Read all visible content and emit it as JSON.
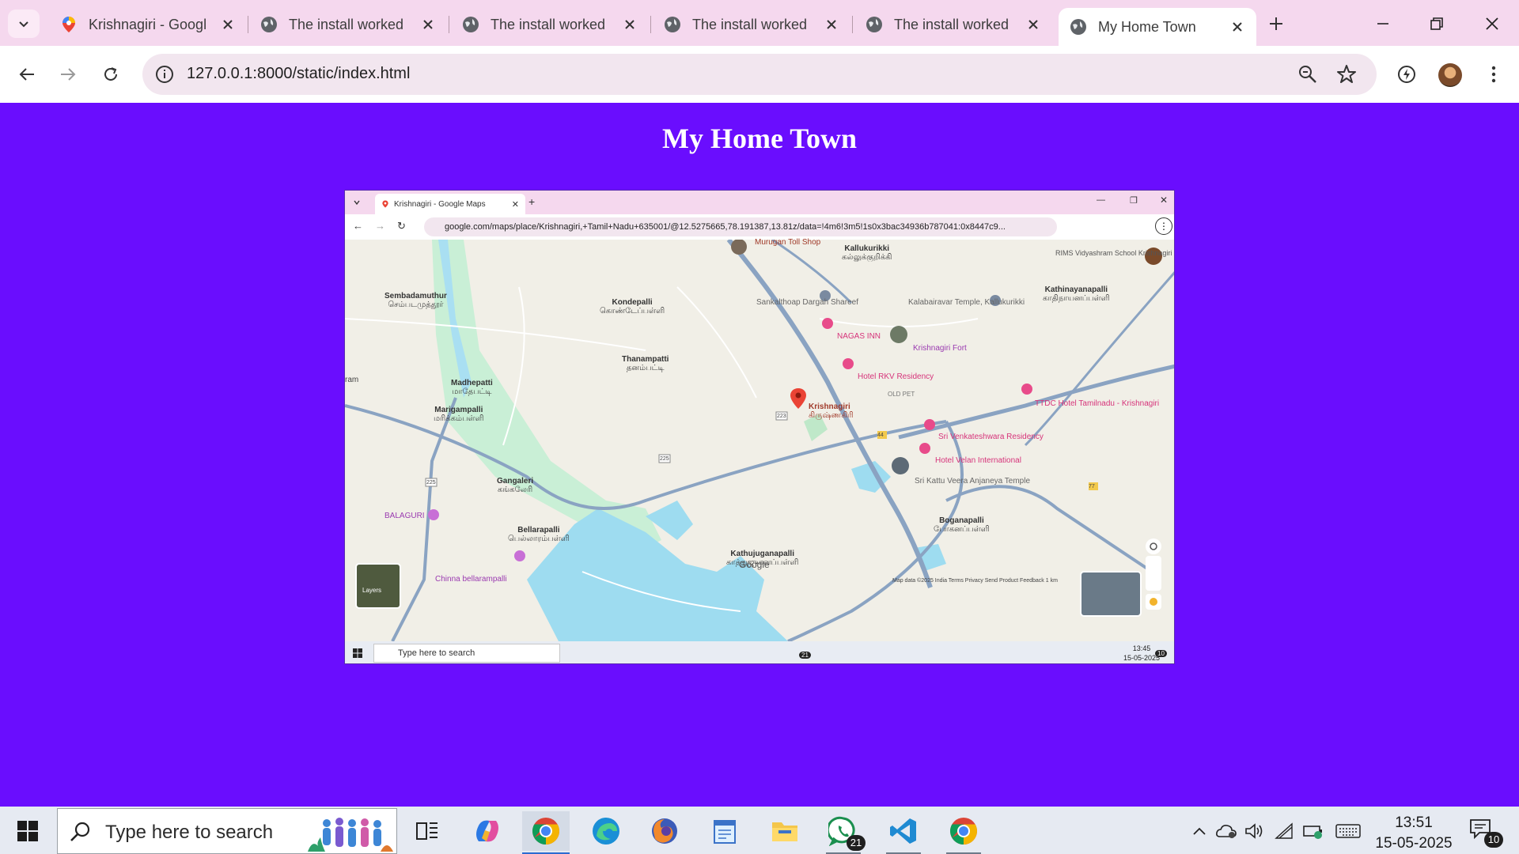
{
  "browser": {
    "tabs": [
      {
        "title": "Krishnagiri - Googl",
        "favicon": "google-maps-pin-icon",
        "active": false
      },
      {
        "title": "The install worked",
        "favicon": "globe-icon",
        "active": false
      },
      {
        "title": "The install worked",
        "favicon": "globe-icon",
        "active": false
      },
      {
        "title": "The install worked",
        "favicon": "globe-icon",
        "active": false
      },
      {
        "title": "The install worked",
        "favicon": "globe-icon",
        "active": false
      },
      {
        "title": "My Home Town",
        "favicon": "globe-icon",
        "active": true
      }
    ],
    "url": "127.0.0.1:8000/static/index.html",
    "accent": "#f5d8ee"
  },
  "page": {
    "title": "My Home Town",
    "background": "#6a0dfe"
  },
  "screenshot": {
    "tab_title": "Krishnagiri - Google Maps",
    "url": "google.com/maps/place/Krishnagiri,+Tamil+Nadu+635001/@12.5275665,78.191387,13.81z/data=!4m6!3m5!1s0x3bac34936b787041:0x8447c9...",
    "labels": {
      "kallukurikki": "Kallukurikki",
      "kallukurikki_ta": "கல்லுக்குறிக்கி",
      "murugan": "Murugan Toll Shop",
      "sembadamuthur": "Sembadamuthur",
      "sembadamuthur_ta": "செம்படமுத்தூர்",
      "kondepalli": "Kondepalli",
      "kondepalli_ta": "கொண்டேப்பள்ளி",
      "sankalthoap": "Sankalthoap Dargah Shareef",
      "kalabairavar": "Kalabairavar Temple, Kallukurikki",
      "kathinayanapalli": "Kathinayanapalli",
      "kathinayanapalli_ta": "காதிநாயனப்பள்ளி",
      "rims": "RIMS Vidyashram School Krishnagiri",
      "nagas": "NAGAS INN",
      "fort": "Krishnagiri Fort",
      "thanampatti": "Thanampatti",
      "thanampatti_ta": "தனம்பட்டி",
      "madhepatti": "Madhepatti",
      "madhepatti_ta": "மாதேபட்டி",
      "rkv": "Hotel RKV Residency",
      "old_pet": "OLD PET",
      "marigampalli": "Marigampalli",
      "marigampalli_ta": "மரிக்கம்பள்ளி",
      "krishnagiri": "Krishnagiri",
      "krishnagiri_ta": "கிருஷ்ணகிரி",
      "ttdc": "TTDC Hotel Tamilnadu - Krishnagiri",
      "venkateshwara": "Sri Venkateshwara Residency",
      "velan": "Hotel Velan International",
      "kattu": "Sri Kattu Veera Anjaneya Temple",
      "gangaleri": "Gangaleri",
      "gangaleri_ta": "கங்கலேரி",
      "boganapalli": "Boganapalli",
      "boganapalli_ta": "போகனப்பள்ளி",
      "balaguri": "BALAGURI",
      "bellarapalli": "Bellarapalli",
      "bellarapalli_ta": "பெல்லாரம்பள்ளி",
      "kathujuganapalli": "Kathujuganapalli",
      "kathujuganapalli_ta": "காத்துஜுகனப்பள்ளி",
      "chinna": "Chinna bellarampalli",
      "layers": "Layers",
      "google": "Google",
      "footer": "Map data ©2025   India   Terms   Privacy   Send Product Feedback   1 km",
      "ram": "ram",
      "road_44": "44",
      "road_77": "77",
      "road_223": "223",
      "road_225": "225",
      "road_225b": "225"
    },
    "taskbar": {
      "search": "Type here to search",
      "time": "13:45",
      "date": "15-05-2025",
      "notifications": "10",
      "whatsapp_badge": "21"
    }
  },
  "taskbar": {
    "search_placeholder": "Type here to search",
    "time": "13:51",
    "date": "15-05-2025",
    "notifications": "10",
    "whatsapp_badge": "21"
  }
}
